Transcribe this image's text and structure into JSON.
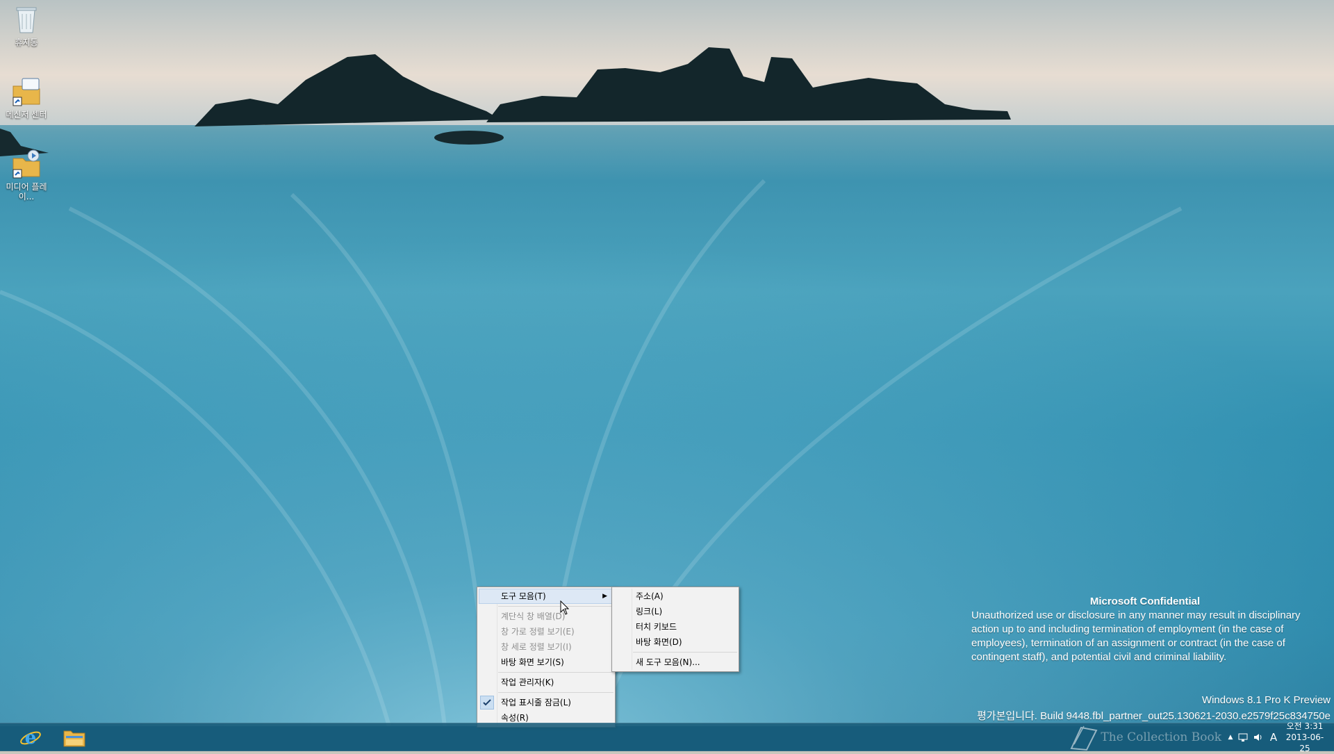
{
  "desktop": {
    "icons": [
      {
        "label": "휴지통",
        "icon": "recycle-bin-icon"
      },
      {
        "label": "메신저 센터",
        "icon": "messenger-center-icon"
      },
      {
        "label": "미디어 플레이...",
        "icon": "media-player-icon"
      }
    ]
  },
  "context_menu": {
    "items": [
      {
        "label": "도구 모음(T)",
        "state": "highlighted",
        "submenu": true
      },
      {
        "label": "계단식 창 배열(D)",
        "state": "disabled"
      },
      {
        "label": "창 가로 정렬 보기(E)",
        "state": "disabled"
      },
      {
        "label": "창 세로 정렬 보기(I)",
        "state": "disabled"
      },
      {
        "label": "바탕 화면 보기(S)",
        "state": "enabled"
      },
      {
        "label": "작업 관리자(K)",
        "state": "enabled"
      },
      {
        "label": "작업 표시줄 잠금(L)",
        "state": "checked"
      },
      {
        "label": "속성(R)",
        "state": "enabled"
      }
    ]
  },
  "toolbar_submenu": {
    "items": [
      {
        "label": "주소(A)"
      },
      {
        "label": "링크(L)"
      },
      {
        "label": "터치 키보드"
      },
      {
        "label": "바탕 화면(D)"
      },
      {
        "label": "새 도구 모음(N)..."
      }
    ]
  },
  "watermark": {
    "title": "Microsoft Confidential",
    "body": "Unauthorized use or disclosure in any manner may result in disciplinary action up to and including termination of employment (in the case of employees), termination of an assignment or contract (in the case of contingent staff), and potential civil and criminal liability.",
    "edition": "Windows 8.1 Pro K Preview",
    "build": "평가본입니다. Build 9448.fbl_partner_out25.130621-2030.e2579f25c834750e"
  },
  "taskbar": {
    "pinned": [
      {
        "name": "Internet Explorer",
        "icon": "internet-explorer-icon"
      },
      {
        "name": "File Explorer",
        "icon": "file-explorer-icon"
      }
    ],
    "tray": {
      "overlay_text": "The Collection Book",
      "keyboard_indicator": "A",
      "time": "오전 3:31",
      "date": "2013-06-25"
    }
  },
  "colors": {
    "menu_background": "#f2f2f2",
    "menu_highlight": "#dde8f5",
    "taskbar": "#185a78",
    "disabled_text": "#8f8f8f"
  }
}
